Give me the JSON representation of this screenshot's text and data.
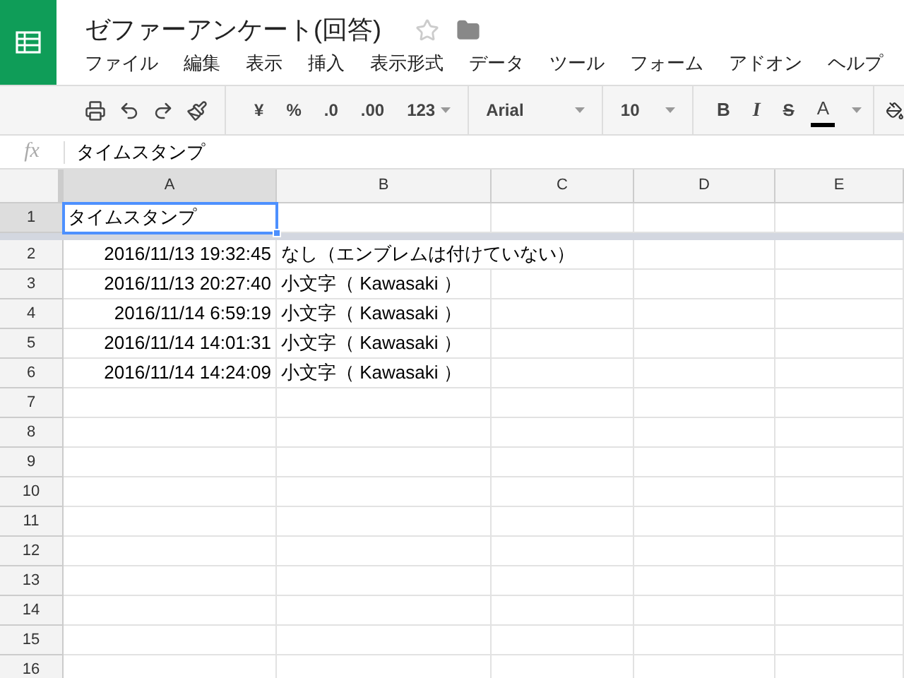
{
  "document": {
    "title": "ゼファーアンケート(回答)",
    "starred": false
  },
  "menu": [
    "ファイル",
    "編集",
    "表示",
    "挿入",
    "表示形式",
    "データ",
    "ツール",
    "フォーム",
    "アドオン",
    "ヘルプ"
  ],
  "toolbar": {
    "currency": "¥",
    "percent": "%",
    "decrease_decimals": ".0",
    "increase_decimals": ".00",
    "more_formats": "123",
    "font": "Arial",
    "font_size": "10",
    "bold": "B",
    "italic": "I",
    "strikethrough": "S",
    "text_color": "A"
  },
  "formula_bar": {
    "label": "fx",
    "value": "タイムスタンプ"
  },
  "columns": [
    {
      "label": "A",
      "selected": true
    },
    {
      "label": "B",
      "selected": false
    },
    {
      "label": "C",
      "selected": false
    },
    {
      "label": "D",
      "selected": false
    },
    {
      "label": "E",
      "selected": false
    }
  ],
  "rows": [
    {
      "number": "1",
      "selected": true,
      "cells": [
        "タイムスタンプ"
      ]
    },
    {
      "number": "2",
      "selected": false,
      "cells": [
        "2016/11/13 19:32:45",
        "なし（エンブレムは付けていない）"
      ]
    },
    {
      "number": "3",
      "selected": false,
      "cells": [
        "2016/11/13 20:27:40",
        "小文字（ Kawasaki ）"
      ]
    },
    {
      "number": "4",
      "selected": false,
      "cells": [
        "2016/11/14 6:59:19",
        "小文字（ Kawasaki ）"
      ]
    },
    {
      "number": "5",
      "selected": false,
      "cells": [
        "2016/11/14 14:01:31",
        "小文字（ Kawasaki ）"
      ]
    },
    {
      "number": "6",
      "selected": false,
      "cells": [
        "2016/11/14 14:24:09",
        "小文字（ Kawasaki ）"
      ]
    },
    {
      "number": "7",
      "selected": false,
      "cells": []
    },
    {
      "number": "8",
      "selected": false,
      "cells": []
    },
    {
      "number": "9",
      "selected": false,
      "cells": []
    },
    {
      "number": "10",
      "selected": false,
      "cells": []
    },
    {
      "number": "11",
      "selected": false,
      "cells": []
    },
    {
      "number": "12",
      "selected": false,
      "cells": []
    },
    {
      "number": "13",
      "selected": false,
      "cells": []
    },
    {
      "number": "14",
      "selected": false,
      "cells": []
    },
    {
      "number": "15",
      "selected": false,
      "cells": []
    },
    {
      "number": "16",
      "selected": false,
      "cells": []
    }
  ]
}
